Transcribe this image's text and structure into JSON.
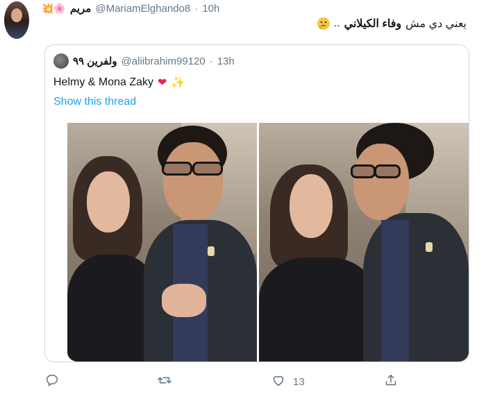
{
  "tweet": {
    "display_name": "مريم",
    "name_emojis": "💥🌸",
    "handle": "@MariamElghando8",
    "separator": "·",
    "time": "10h",
    "text_prefix": "يعني دي مش",
    "text_bold": "وفاء الكيلاني",
    "text_suffix": "..",
    "emoji_icon": "thinking-face-icon"
  },
  "quoted": {
    "display_name": "ولفرين ٩٩",
    "handle": "@aliibrahim99120",
    "separator": "·",
    "time": "13h",
    "text": "Helmy & Mona Zaky",
    "emoji_1": "❤",
    "emoji_2": "✨",
    "show_thread": "Show this thread"
  },
  "actions": {
    "reply_icon": "reply-icon",
    "retweet_icon": "retweet-icon",
    "like_icon": "heart-icon",
    "like_count": "13",
    "share_icon": "share-icon"
  },
  "colors": {
    "link": "#1da1f2",
    "muted": "#657786",
    "border": "#ccd6dd",
    "heart": "#e0245e"
  }
}
